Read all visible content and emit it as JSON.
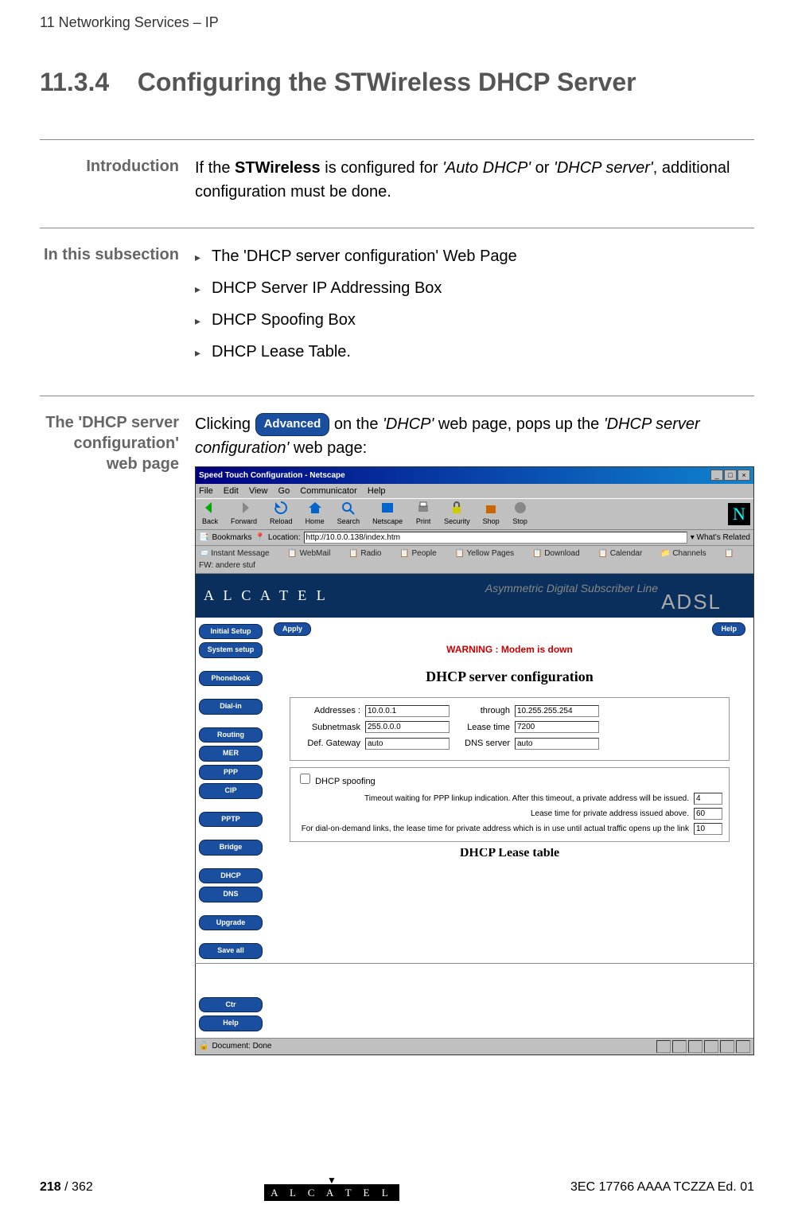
{
  "header": {
    "breadcrumb": "11 Networking Services – IP"
  },
  "section": {
    "number": "11.3.4",
    "title": "Configuring the STWireless DHCP Server"
  },
  "introduction": {
    "label": "Introduction",
    "text_prefix": "If the ",
    "text_bold": "STWireless",
    "text_mid": " is configured for ",
    "text_italic1": "'Auto DHCP'",
    "text_or": " or ",
    "text_italic2": "'DHCP server'",
    "text_suffix": ", additional configuration must be done."
  },
  "subsection_list": {
    "label": "In this subsection",
    "items": [
      "The 'DHCP server configuration' Web Page",
      "DHCP Server IP Addressing Box",
      "DHCP Spoofing Box",
      "DHCP Lease Table."
    ]
  },
  "dhcp_page": {
    "label": "The 'DHCP server configuration' web page",
    "text_prefix": "Clicking ",
    "button_label": "Advanced",
    "text_mid": " on the ",
    "text_italic1": "'DHCP'",
    "text_mid2": " web page, pops up the ",
    "text_italic2": "'DHCP server configuration'",
    "text_suffix": " web page:"
  },
  "screenshot": {
    "title": "Speed Touch Configuration - Netscape",
    "menus": [
      "File",
      "Edit",
      "View",
      "Go",
      "Communicator",
      "Help"
    ],
    "toolbar": [
      "Back",
      "Forward",
      "Reload",
      "Home",
      "Search",
      "Netscape",
      "Print",
      "Security",
      "Shop",
      "Stop"
    ],
    "addr_label": "Bookmarks",
    "location_label": "Location:",
    "url": "http://10.0.0.138/index.htm",
    "whats_related": "What's Related",
    "links": [
      "Instant Message",
      "WebMail",
      "Radio",
      "People",
      "Yellow Pages",
      "Download",
      "Calendar",
      "Channels",
      "FW: andere stuf"
    ],
    "banner_logo": "A L C A T E L",
    "banner_tag": "Asymmetric Digital Subscriber Line",
    "banner_adsl": "ADSL",
    "nav": [
      "Initial Setup",
      "System setup",
      "Phonebook",
      "Dial-in",
      "Routing",
      "MER",
      "PPP",
      "CIP",
      "PPTP",
      "Bridge",
      "DHCP",
      "DNS",
      "Upgrade",
      "Save all"
    ],
    "nav_bottom": [
      "Ctr",
      "Help"
    ],
    "apply": "Apply",
    "help": "Help",
    "warning": "WARNING : Modem is down",
    "panel_title": "DHCP server configuration",
    "form": {
      "addresses_label": "Addresses :",
      "addresses_val": "10.0.0.1",
      "through_label": "through",
      "through_val": "10.255.255.254",
      "subnet_label": "Subnetmask",
      "subnet_val": "255.0.0.0",
      "lease_label": "Lease time",
      "lease_val": "7200",
      "gateway_label": "Def. Gateway",
      "gateway_val": "auto",
      "dns_label": "DNS server",
      "dns_val": "auto"
    },
    "spoofing": {
      "checkbox_label": "DHCP spoofing",
      "row1_text": "Timeout waiting for PPP linkup indication. After this timeout, a private address will be issued.",
      "row1_val": "4",
      "row2_text": "Lease time for private address issued above.",
      "row2_val": "60",
      "row3_text": "For dial-on-demand links, the lease time for private address which is in use until actual traffic opens up the link",
      "row3_val": "10"
    },
    "lease_title": "DHCP Lease table",
    "status": "Document: Done"
  },
  "footer": {
    "page_num": "218",
    "page_total": " / 362",
    "logo": "A L C A T E L",
    "doc_id": "3EC 17766 AAAA TCZZA Ed. 01"
  }
}
